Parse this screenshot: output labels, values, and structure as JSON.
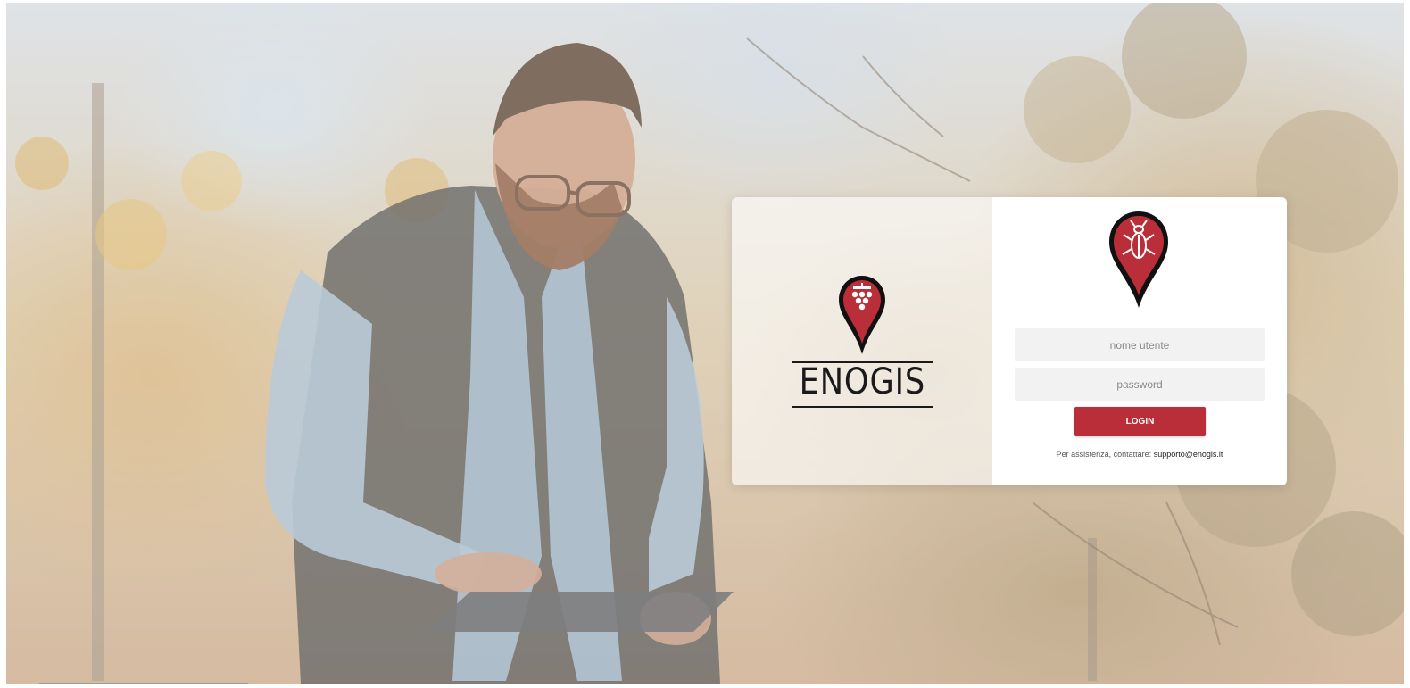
{
  "brand": {
    "name": "ENOGIS",
    "accent_color": "#b92e38",
    "logo_icon": "grape-pin-icon",
    "secondary_icon": "insect-pin-icon"
  },
  "login": {
    "username_placeholder": "nome utente",
    "password_placeholder": "password",
    "button_label": "LOGIN",
    "support_text": "Per assistenza, contattare:",
    "support_email": "supporto@enogis.it"
  },
  "background": {
    "subject": "man-with-tablet-in-vineyard-photo"
  }
}
